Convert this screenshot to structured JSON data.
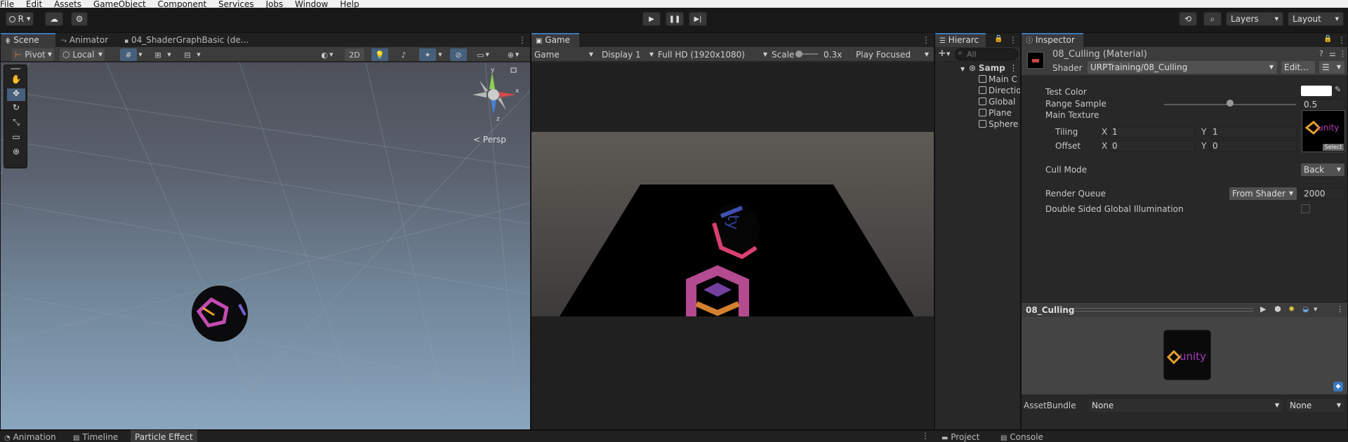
{
  "menubar": [
    "File",
    "Edit",
    "Assets",
    "GameObject",
    "Component",
    "Services",
    "Jobs",
    "Window",
    "Help"
  ],
  "toolbar": {
    "account_label": "R",
    "layers_label": "Layers",
    "layout_label": "Layout"
  },
  "scene": {
    "tabs": [
      "Scene",
      "Animator",
      "04_ShaderGraphBasic (de..."
    ],
    "pivot_label": "Pivot",
    "local_label": "Local",
    "mode_2d_label": "2D",
    "persp_label": "< Persp",
    "gizmo_axes": [
      "y",
      "x",
      "z"
    ]
  },
  "game": {
    "tab": "Game",
    "view_select": "Game",
    "display_select": "Display 1",
    "resolution_select": "Full HD (1920x1080)",
    "scale_label": "Scale",
    "scale_value": "0.3x",
    "play_mode_select": "Play Focused",
    "scale_slider_fraction": 0.1
  },
  "hierarchy": {
    "tab": "Hierarc",
    "search_placeholder": "All",
    "scene_name": "Samp",
    "items": [
      "Main C",
      "Directio",
      "Global",
      "Plane",
      "Sphere"
    ]
  },
  "inspector": {
    "tab": "Inspector",
    "material_name": "08_Culling (Material)",
    "shader_label": "Shader",
    "shader_value": "URPTraining/08_Culling",
    "edit_label": "Edit...",
    "props": {
      "test_color_label": "Test Color",
      "range_sample_label": "Range Sample",
      "range_sample_value": "0.5",
      "range_sample_fraction": 0.5,
      "main_texture_label": "Main Texture",
      "tiling_label": "Tiling",
      "offset_label": "Offset",
      "x_label": "X",
      "y_label": "Y",
      "tiling_x": "1",
      "tiling_y": "1",
      "offset_x": "0",
      "offset_y": "0",
      "select_label": "Select",
      "texture_text": "unity",
      "cull_mode_label": "Cull Mode",
      "cull_mode_value": "Back",
      "render_queue_label": "Render Queue",
      "render_queue_source": "From Shader",
      "render_queue_value": "2000",
      "dsgi_label": "Double Sided Global Illumination"
    },
    "preview": {
      "title": "08_Culling",
      "cube_text": "unity"
    },
    "assetbundle": {
      "label": "AssetBundle",
      "name_value": "None",
      "variant_value": "None"
    }
  },
  "bottom_left_tabs": [
    "Animation",
    "Timeline",
    "Particle Effect"
  ],
  "bottom_right_tabs": [
    "Project",
    "Console"
  ],
  "colors": {
    "accent": "#3a79bb",
    "panel": "#282828",
    "toolbar": "#3c3c3c",
    "menubar": "#f0f0f0"
  }
}
